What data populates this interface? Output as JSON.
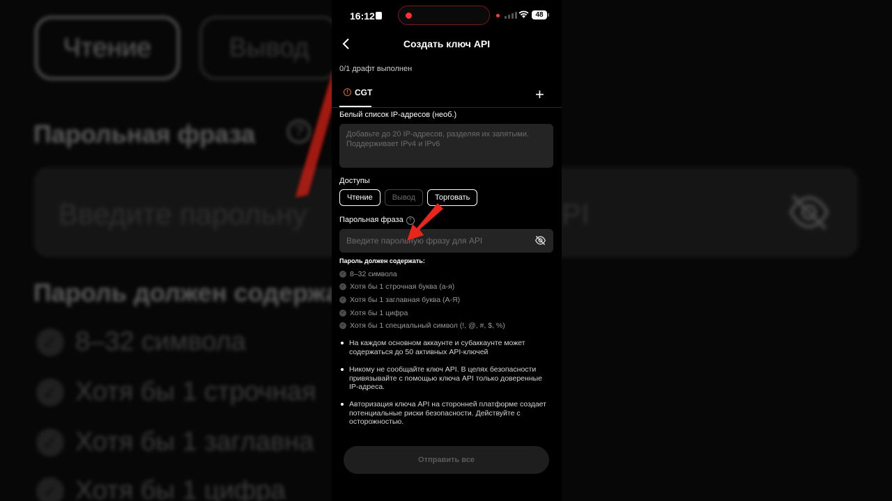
{
  "background": {
    "btn_read": "Чтение",
    "btn_withdraw": "Вывод",
    "passphrase_title": "Парольная фраза",
    "help_glyph": "?",
    "passphrase_placeholder": "Введите парольну",
    "passphrase_placeholder_tail": "PI",
    "req_title": "Пароль должен содержат",
    "req_items": [
      "8–32 символа",
      "Хотя бы 1 строчная",
      "Хотя бы 1 заглавна",
      "Хотя бы 1 цифра"
    ]
  },
  "status_bar": {
    "time": "16:12",
    "battery": "48"
  },
  "header": {
    "title": "Создать ключ API"
  },
  "draft_status": "0/1 драфт выполнен",
  "tabs": [
    {
      "label": "CGT",
      "warning_glyph": "!"
    }
  ],
  "add_tab_glyph": "+",
  "whitelist": {
    "label": "Белый список IP-адресов (необ.)",
    "placeholder_line1": "Добавьте до 20 IP-адресов, разделяя их запятыми.",
    "placeholder_line2": "Поддерживает IPv4 и IPv6"
  },
  "permissions": {
    "label": "Доступы",
    "options": [
      {
        "label": "Чтение",
        "enabled": true
      },
      {
        "label": "Вывод",
        "enabled": false
      },
      {
        "label": "Торговать",
        "enabled": true
      }
    ]
  },
  "passphrase": {
    "label": "Парольная фраза",
    "help_glyph": "?",
    "placeholder": "Введите парольную фразу для API"
  },
  "requirements": {
    "title": "Пароль должен содержать:",
    "items": [
      "8–32 символа",
      "Хотя бы 1 строчная буква (а-я)",
      "Хотя бы 1 заглавная буква (А-Я)",
      "Хотя бы 1 цифра",
      "Хотя бы 1 специальный символ (!, @, #, $, %)"
    ]
  },
  "notes": [
    "На каждом основном аккаунте и субаккаунте может содержаться до 50 активных API-ключей",
    "Никому не сообщайте ключ API. В целях безопасности привязывайте с помощью ключа API только доверенные IP-адреса.",
    "Авторизация ключа API на сторонней платформе создает потенциальные риски безопасности. Действуйте с осторожностью."
  ],
  "submit_label": "Отправить все",
  "colors": {
    "accent_red": "#e8261c",
    "warning_orange": "#e06a28",
    "field_bg": "#242424"
  }
}
